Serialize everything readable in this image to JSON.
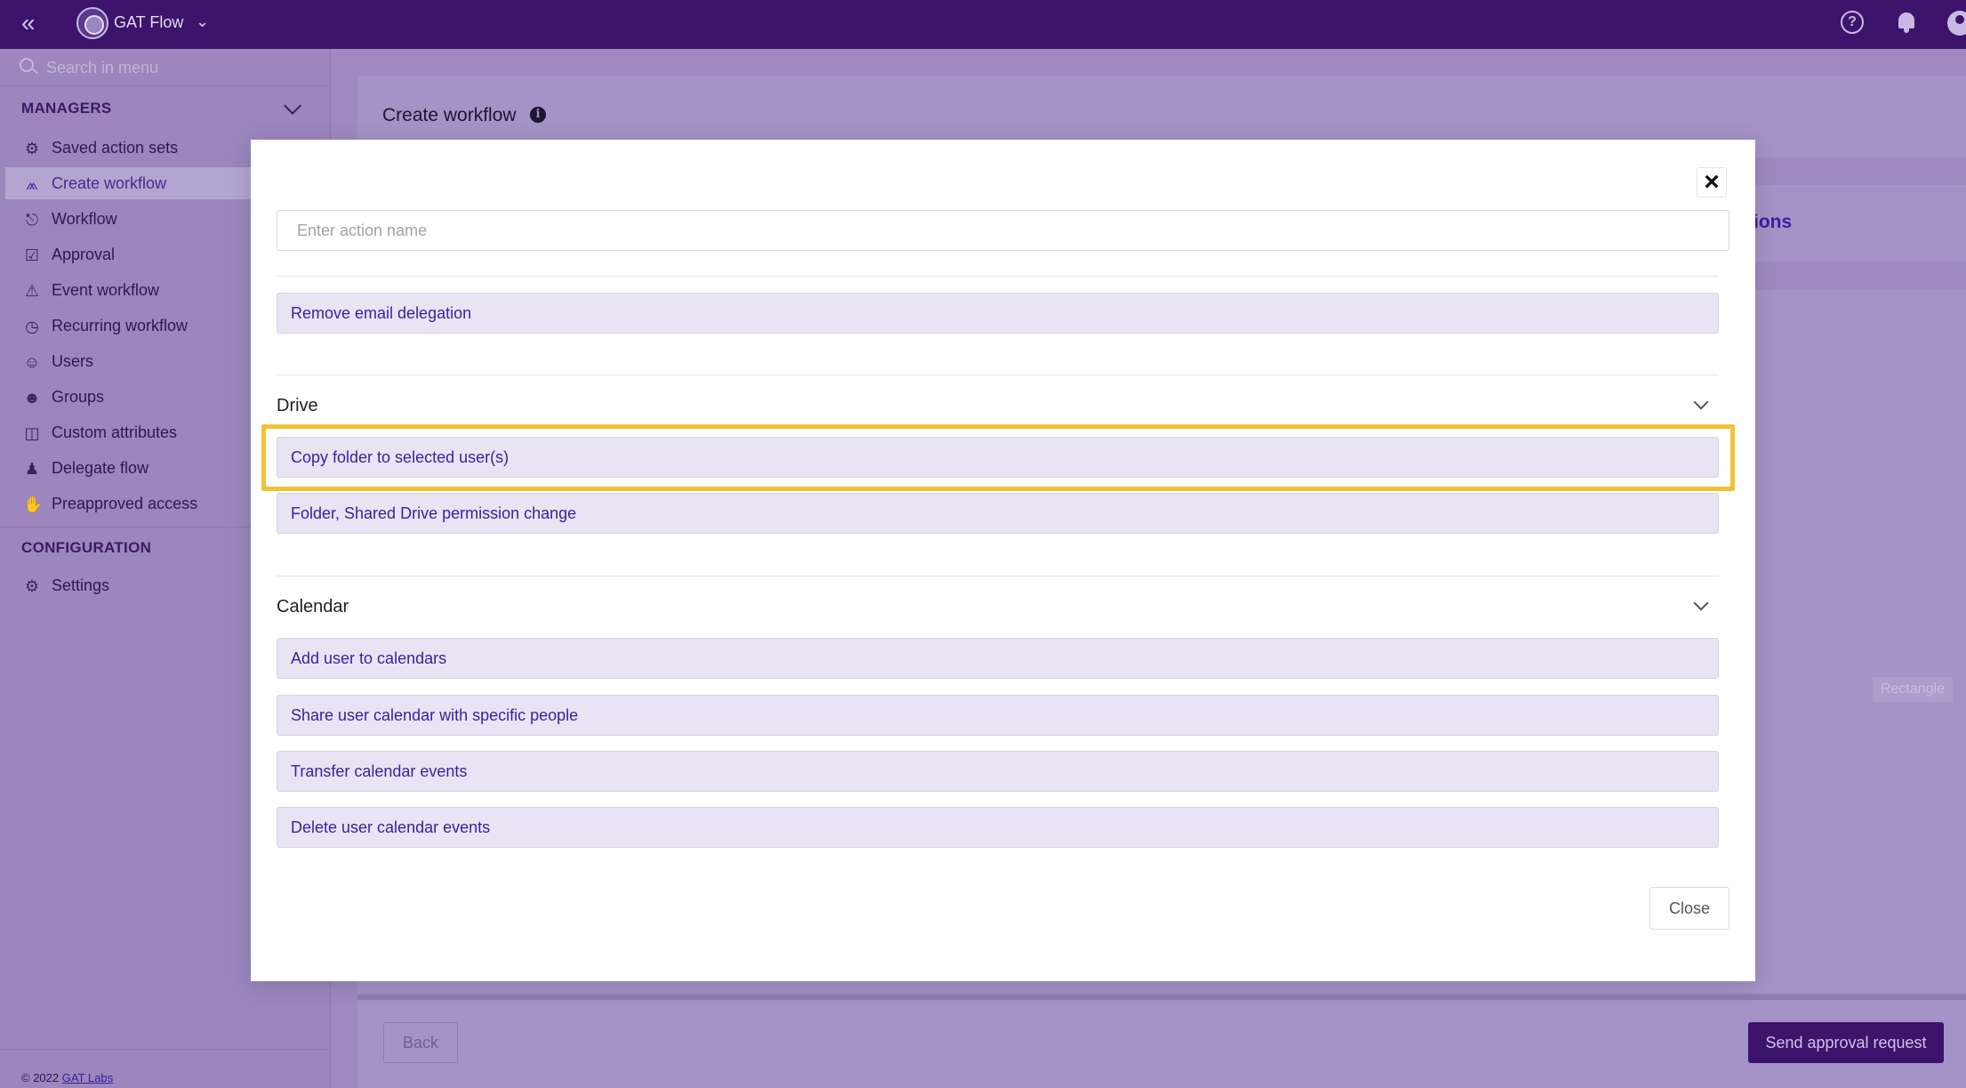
{
  "topbar": {
    "app_name": "GAT Flow"
  },
  "sidebar": {
    "search_placeholder": "Search in menu",
    "managers_heading": "MANAGERS",
    "config_heading": "CONFIGURATION",
    "items": [
      {
        "label": "Saved action sets",
        "icon": "gear-stack-icon"
      },
      {
        "label": "Create workflow",
        "icon": "branch-icon"
      },
      {
        "label": "Workflow",
        "icon": "hierarchy-icon"
      },
      {
        "label": "Approval",
        "icon": "approval-icon"
      },
      {
        "label": "Event workflow",
        "icon": "siren-icon"
      },
      {
        "label": "Recurring workflow",
        "icon": "clock-icon"
      },
      {
        "label": "Users",
        "icon": "user-search-icon"
      },
      {
        "label": "Groups",
        "icon": "group-icon"
      },
      {
        "label": "Custom attributes",
        "icon": "table-icon"
      },
      {
        "label": "Delegate flow",
        "icon": "user-question-icon"
      },
      {
        "label": "Preapproved access",
        "icon": "hand-icon"
      }
    ],
    "settings_label": "Settings",
    "footer_text": "© 2022",
    "footer_link": "GAT Labs"
  },
  "main": {
    "title": "Create workflow",
    "partial_heading": "ions",
    "rectangle_tag": "Rectangle",
    "back_label": "Back",
    "send_label": "Send approval request"
  },
  "modal": {
    "input_placeholder": "Enter action name",
    "top_action": "Remove email delegation",
    "groups": [
      {
        "name": "Drive",
        "actions": [
          "Copy folder to selected user(s)",
          "Folder, Shared Drive permission change"
        ]
      },
      {
        "name": "Calendar",
        "actions": [
          "Add user to calendars",
          "Share user calendar with specific people",
          "Transfer calendar events",
          "Delete user calendar events"
        ]
      }
    ],
    "close_label": "Close"
  },
  "colors": {
    "topbar": "#3d146c",
    "accent": "#3b1ea0",
    "highlight": "#f2c236",
    "action_bg": "#e8e4f3"
  }
}
